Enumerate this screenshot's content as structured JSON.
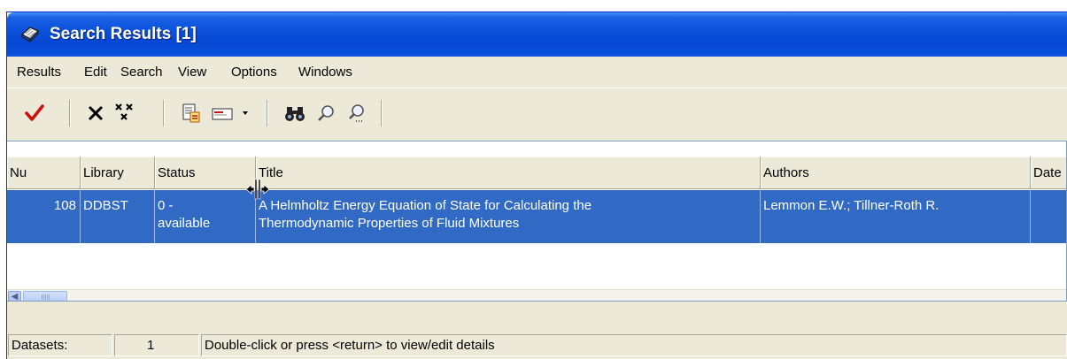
{
  "window": {
    "title": "Search Results [1]",
    "title_icon": "book-icon"
  },
  "menu": {
    "items": [
      "Results",
      "Edit",
      "Search",
      "View",
      "Options",
      "Windows"
    ]
  },
  "toolbar": {
    "tools": [
      {
        "name": "accept-checkmark-icon",
        "tooltip": ""
      },
      {
        "name": "delete-x-icon",
        "tooltip": ""
      },
      {
        "name": "delete-all-icon",
        "tooltip": ""
      },
      {
        "name": "export-document-icon",
        "tooltip": ""
      },
      {
        "name": "send-mail-icon",
        "tooltip": ""
      },
      {
        "name": "dropdown-arrow-icon",
        "tooltip": ""
      },
      {
        "name": "binoculars-icon",
        "tooltip": ""
      },
      {
        "name": "magnifier-icon",
        "tooltip": ""
      },
      {
        "name": "magnifier-dots-icon",
        "tooltip": ""
      }
    ]
  },
  "table": {
    "columns": [
      "Nu",
      "Library",
      "Status",
      "Title",
      "Authors",
      "Date"
    ],
    "rows": [
      {
        "nu": "108",
        "library": "DDBST",
        "status_line1": "0 -",
        "status_line2": "available",
        "title_line1": "A Helmholtz Energy Equation of State for Calculating the",
        "title_line2": "Thermodynamic Properties of Fluid Mixtures",
        "authors": "Lemmon E.W.; Tillner-Roth R.",
        "date": ""
      }
    ]
  },
  "status": {
    "datasets_label": "Datasets:",
    "datasets_count": "1",
    "hint": "Double-click or press <return> to view/edit details"
  },
  "colors": {
    "title_bar": "#0a4fd8",
    "selection": "#316ac5",
    "window_bg": "#ece9d8"
  }
}
